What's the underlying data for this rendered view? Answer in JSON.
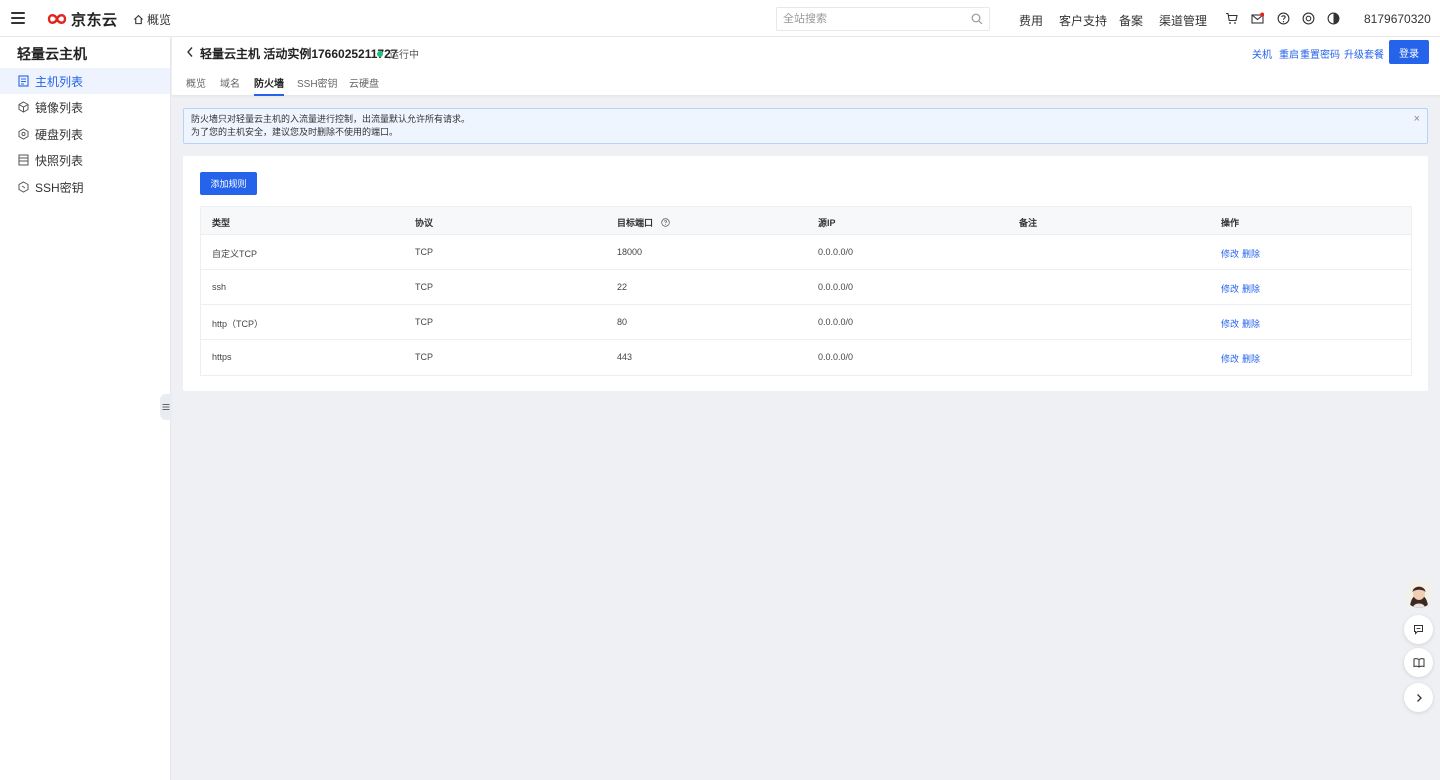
{
  "brand": {
    "logo_text": "京东云"
  },
  "topbar": {
    "overview": "概览",
    "search_placeholder": "全站搜索",
    "links": [
      "费用",
      "客户支持",
      "备案",
      "渠道管理"
    ],
    "account_id": "8179670320"
  },
  "sidebar": {
    "title": "轻量云主机",
    "items": [
      {
        "label": "主机列表",
        "icon": "host-list-icon",
        "active": true
      },
      {
        "label": "镜像列表",
        "icon": "image-icon",
        "active": false
      },
      {
        "label": "硬盘列表",
        "icon": "disk-icon",
        "active": false
      },
      {
        "label": "快照列表",
        "icon": "snapshot-icon",
        "active": false
      },
      {
        "label": "SSH密钥",
        "icon": "ssh-key-icon",
        "active": false
      }
    ]
  },
  "header": {
    "title": "轻量云主机 活动实例1766025211727",
    "status": "运行中",
    "actions": {
      "shutdown": "关机",
      "restart": "重启",
      "reset_password": "重置密码",
      "upgrade": "升级套餐"
    },
    "login": "登录"
  },
  "tabs": [
    "概览",
    "域名",
    "防火墙",
    "SSH密钥",
    "云硬盘"
  ],
  "active_tab": "防火墙",
  "alert": {
    "line1": "防火墙只对轻量云主机的入流量进行控制，出流量默认允许所有请求。",
    "line2": "为了您的主机安全，建议您及时删除不使用的端口。"
  },
  "firewall": {
    "add_button": "添加规则",
    "columns": [
      "类型",
      "协议",
      "目标端口",
      "源IP",
      "备注",
      "操作"
    ],
    "rows": [
      {
        "type": "自定义TCP",
        "protocol": "TCP",
        "port": "18000",
        "source": "0.0.0.0/0",
        "note": ""
      },
      {
        "type": "ssh",
        "protocol": "TCP",
        "port": "22",
        "source": "0.0.0.0/0",
        "note": ""
      },
      {
        "type": "http（TCP）",
        "protocol": "TCP",
        "port": "80",
        "source": "0.0.0.0/0",
        "note": ""
      },
      {
        "type": "https",
        "protocol": "TCP",
        "port": "443",
        "source": "0.0.0.0/0",
        "note": ""
      }
    ],
    "edit_label": "修改",
    "delete_label": "删除"
  },
  "colors": {
    "accent": "#2563eb",
    "status_running": "#1cc17b",
    "brand_red": "#e1251b"
  }
}
